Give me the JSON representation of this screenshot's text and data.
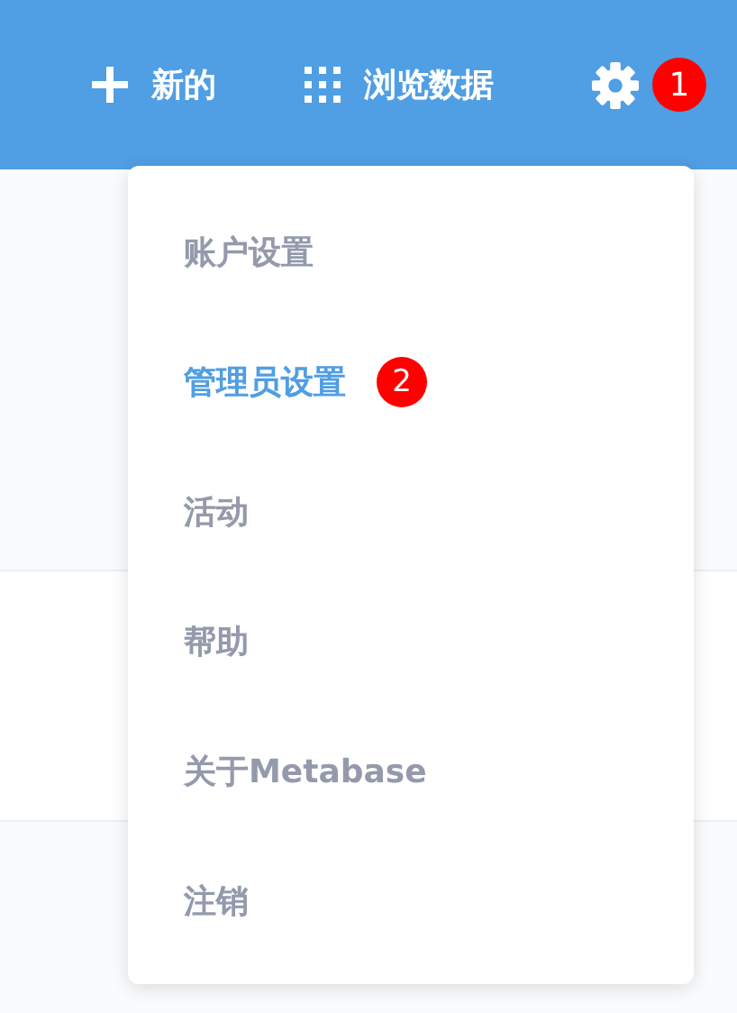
{
  "top_bar": {
    "actions": [
      {
        "kind": "new",
        "label": "新的"
      },
      {
        "kind": "browse",
        "label": "浏览数据"
      }
    ],
    "settings": {
      "badge": "1"
    }
  },
  "menu": {
    "items": [
      {
        "label": "账户设置",
        "selected": false
      },
      {
        "label": "管理员设置",
        "selected": true,
        "badge": "2"
      },
      {
        "label": "活动",
        "selected": false
      },
      {
        "label": "帮助",
        "selected": false
      },
      {
        "label": "关于Metabase",
        "selected": false
      },
      {
        "label": "注销",
        "selected": false
      }
    ]
  }
}
